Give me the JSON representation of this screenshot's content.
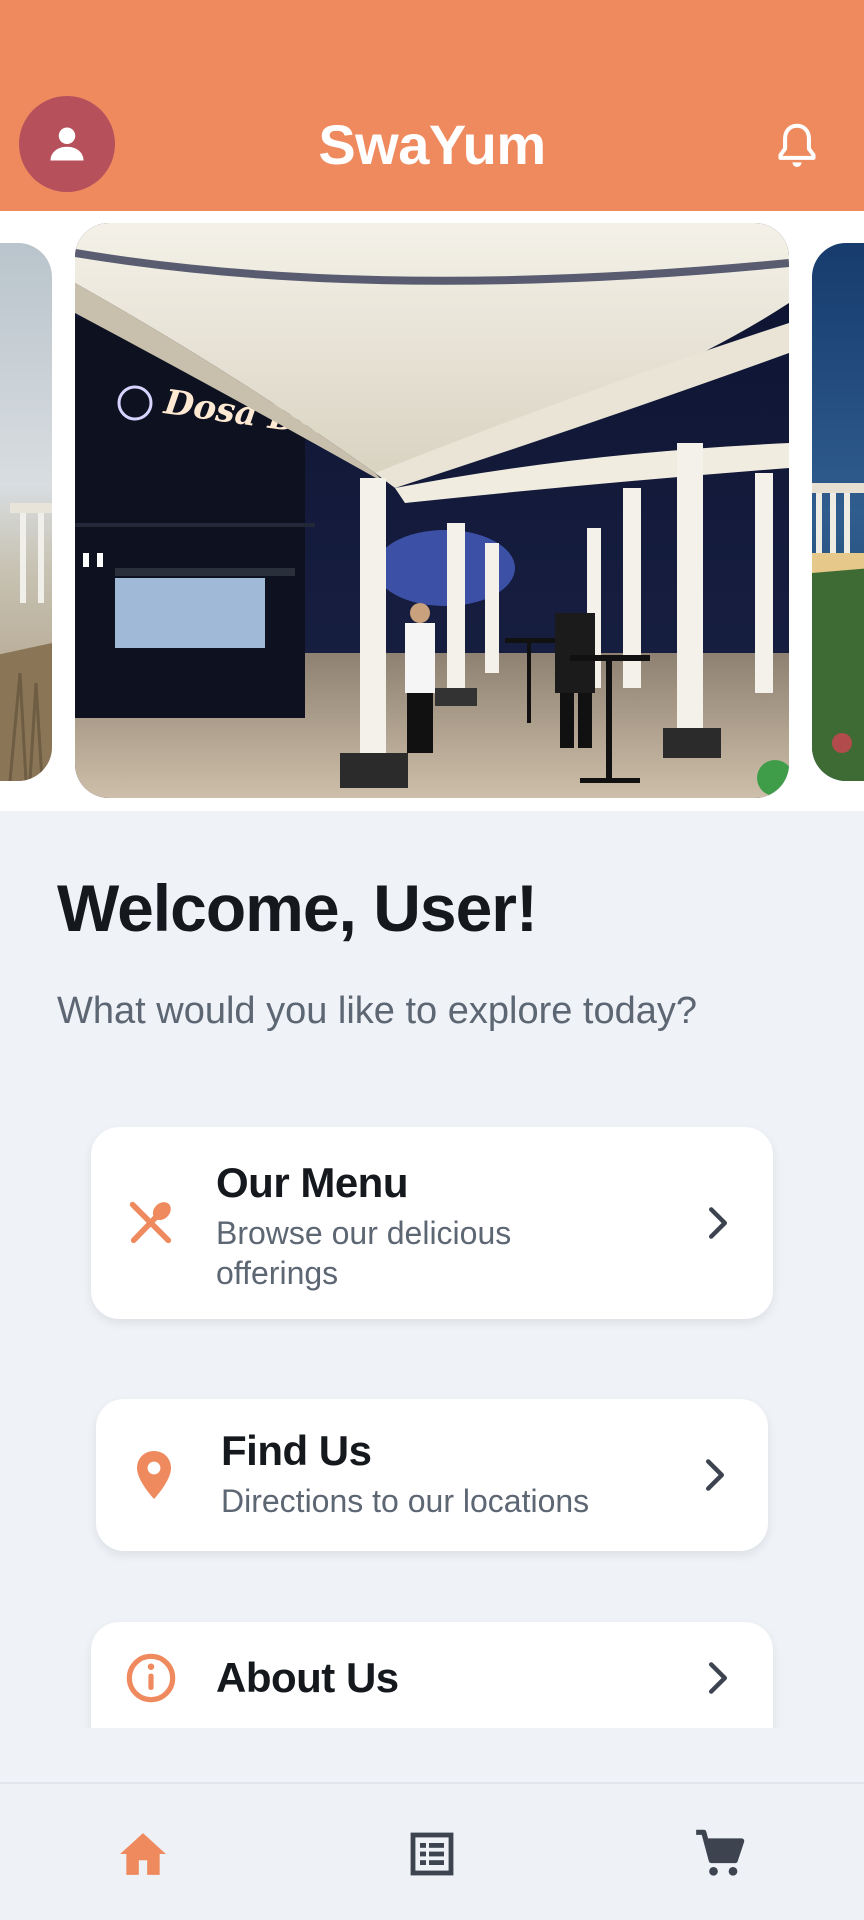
{
  "app": {
    "title": "SwaYum",
    "accent_color": "#ef8a5f",
    "avatar_color": "#b6515c"
  },
  "header": {
    "avatar_icon": "user-icon",
    "bell_icon": "bell-icon"
  },
  "carousel": {
    "slides": [
      {
        "sign_text": "Dosa Diner"
      }
    ]
  },
  "welcome": {
    "title": "Welcome, User!",
    "subtitle": "What would you like to explore today?"
  },
  "cards": [
    {
      "title": "Our Menu",
      "description": "Browse our delicious offerings",
      "icon": "fork-spoon-icon"
    },
    {
      "title": "Find Us",
      "description": "Directions to our locations",
      "icon": "location-pin-icon"
    },
    {
      "title": "About Us",
      "description": "",
      "icon": "info-icon"
    }
  ],
  "bottom_nav": {
    "items": [
      {
        "icon": "home-icon",
        "active": true
      },
      {
        "icon": "list-icon",
        "active": false
      },
      {
        "icon": "cart-icon",
        "active": false
      }
    ]
  }
}
